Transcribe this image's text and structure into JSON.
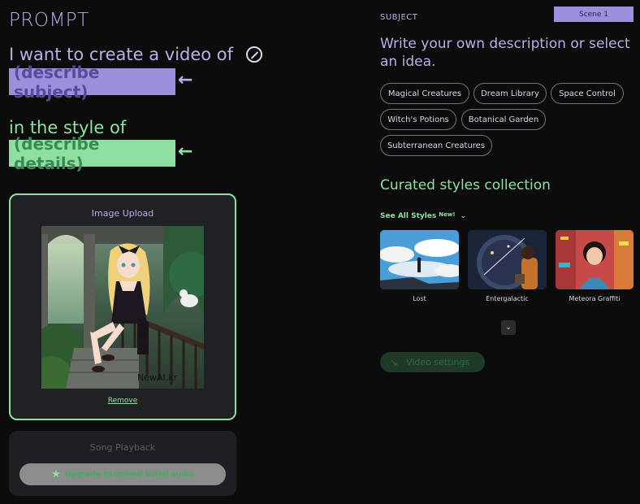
{
  "prompt": {
    "title": "PROMPT",
    "line1": "I want to create a video of",
    "subject_placeholder": "(describe subject)",
    "line2": "in the style of",
    "details_placeholder": "(describe details)",
    "arrow_glyph": "←",
    "icons": [
      "wand-icon",
      "arrow-left-icon"
    ]
  },
  "image_upload": {
    "title": "Image Upload",
    "remove_label": "Remove",
    "watermark": "NewAI.kr"
  },
  "song": {
    "title": "Song Playback",
    "upgrade_label": "Upgrade to upload initial audio",
    "icon": "star-icon"
  },
  "subject": {
    "label": "SUBJECT",
    "scene_badge": "Scene 1",
    "heading": "Write your own description or select an idea.",
    "ideas": [
      "Magical Creatures",
      "Dream Library",
      "Space Control",
      "Witch's Potions",
      "Botanical Garden",
      "Subterranean Creatures"
    ]
  },
  "styles": {
    "heading": "Curated styles collection",
    "see_all": "See All Styles",
    "new_badge": "New!",
    "cards": [
      {
        "label": "Lost"
      },
      {
        "label": "Entergalactic"
      },
      {
        "label": "Meteora Graffiti"
      }
    ]
  },
  "video_settings": {
    "label": "Video settings",
    "icon": "arrow-icon"
  },
  "colors": {
    "background": "#0c0c0d",
    "lavender": "#9d8fdc",
    "mint": "#8fe0a0",
    "card": "#1f2125"
  }
}
